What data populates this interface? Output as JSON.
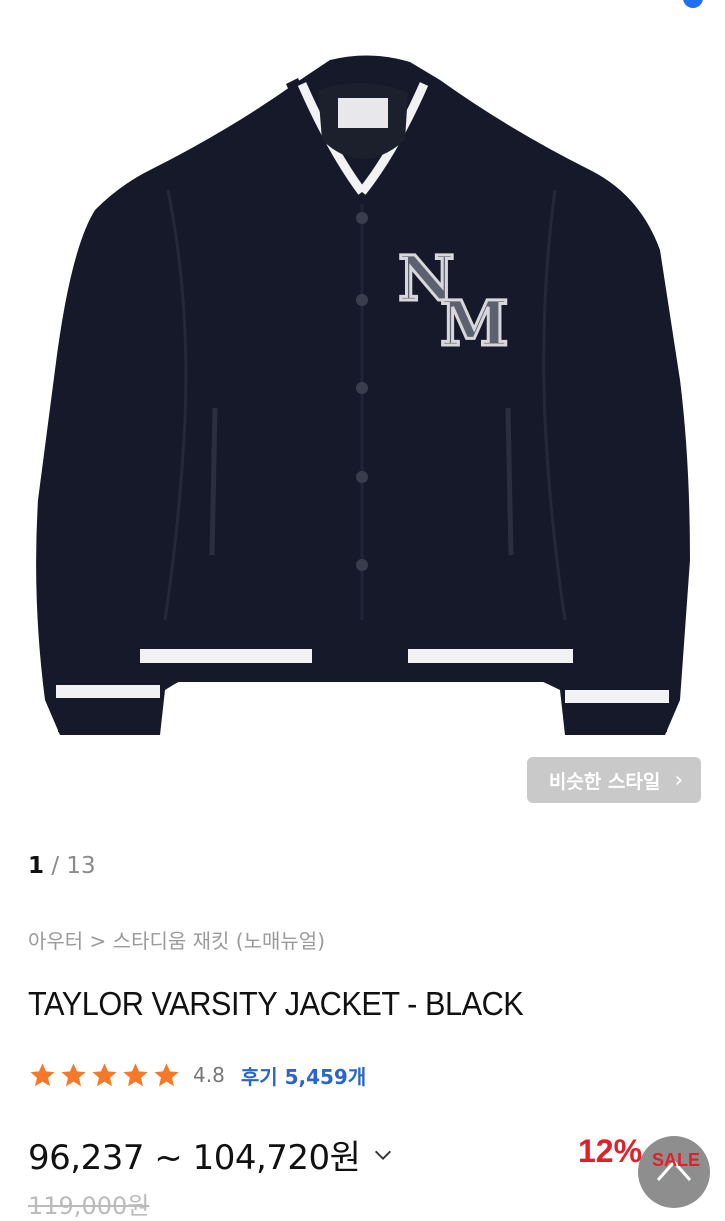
{
  "colors": {
    "jacket_navy": "#16192a",
    "stripe_white": "#f2f2f4",
    "patch_gray": "#5c6170",
    "star_orange": "#f47a2a",
    "review_blue": "#2a66c9",
    "sale_red": "#e0202a"
  },
  "gallery": {
    "similar_style_label": "비슷한 스타일",
    "similar_style_icon": "chevron-right-icon",
    "current_page": "1",
    "page_separator": " / ",
    "total_pages": "13"
  },
  "product": {
    "breadcrumb": "아우터 > 스타디움 재킷 (노매뉴얼)",
    "title": "TAYLOR VARSITY JACKET - BLACK",
    "patch_letters": [
      "N",
      "M"
    ],
    "rating_stars": 5,
    "rating": "4.8",
    "reviews_label": "후기 5,459개",
    "price_range": "96,237 ~ 104,720원",
    "discount": "12%",
    "sale_badge": "SALE",
    "original_price": "119,000원"
  }
}
